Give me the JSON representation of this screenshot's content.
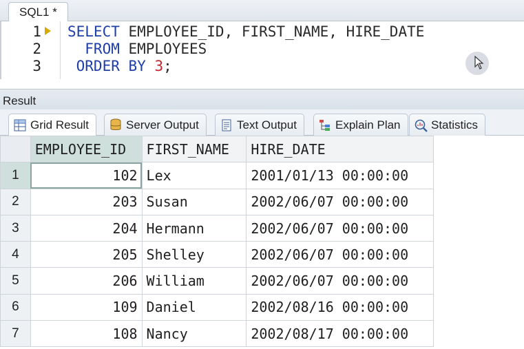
{
  "editor": {
    "tab_label": "SQL1 *",
    "lines": [
      {
        "number": "1",
        "tokens": [
          {
            "t": "SELECT",
            "c": "kw"
          },
          {
            "t": " EMPLOYEE_ID, FIRST_NAME, HIRE_DATE",
            "c": "id"
          }
        ]
      },
      {
        "number": "2",
        "tokens": [
          {
            "t": "  FROM",
            "c": "kw"
          },
          {
            "t": " EMPLOYEES",
            "c": "id"
          }
        ]
      },
      {
        "number": "3",
        "tokens": [
          {
            "t": " ORDER BY",
            "c": "kw"
          },
          {
            "t": " ",
            "c": "id"
          },
          {
            "t": "3",
            "c": "num"
          },
          {
            "t": ";",
            "c": "id"
          }
        ]
      }
    ]
  },
  "result": {
    "title": "Result",
    "tabs": [
      {
        "label": "Grid Result",
        "icon": "grid-icon",
        "active": true
      },
      {
        "label": "Server Output",
        "icon": "database-icon",
        "active": false
      },
      {
        "label": "Text Output",
        "icon": "document-icon",
        "active": false
      },
      {
        "label": "Explain Plan",
        "icon": "tree-icon",
        "active": false
      },
      {
        "label": "Statistics",
        "icon": "magnifier-icon",
        "active": false
      }
    ],
    "columns": [
      "EMPLOYEE_ID",
      "FIRST_NAME",
      "HIRE_DATE"
    ],
    "rows": [
      {
        "no": "1",
        "employee_id": "102",
        "first_name": "Lex",
        "hire_date": "2001/01/13 00:00:00"
      },
      {
        "no": "2",
        "employee_id": "203",
        "first_name": "Susan",
        "hire_date": "2002/06/07 00:00:00"
      },
      {
        "no": "3",
        "employee_id": "204",
        "first_name": "Hermann",
        "hire_date": "2002/06/07 00:00:00"
      },
      {
        "no": "4",
        "employee_id": "205",
        "first_name": "Shelley",
        "hire_date": "2002/06/07 00:00:00"
      },
      {
        "no": "5",
        "employee_id": "206",
        "first_name": "William",
        "hire_date": "2002/06/07 00:00:00"
      },
      {
        "no": "6",
        "employee_id": "109",
        "first_name": "Daniel",
        "hire_date": "2002/08/16 00:00:00"
      },
      {
        "no": "7",
        "employee_id": "108",
        "first_name": "Nancy",
        "hire_date": "2002/08/17 00:00:00"
      }
    ],
    "selected_row": "1"
  },
  "colors": {
    "keyword": "#1e3ea8",
    "number_literal": "#c0262b",
    "execute_marker": "#d8a800",
    "selected_highlight": "#cfe0dc"
  }
}
